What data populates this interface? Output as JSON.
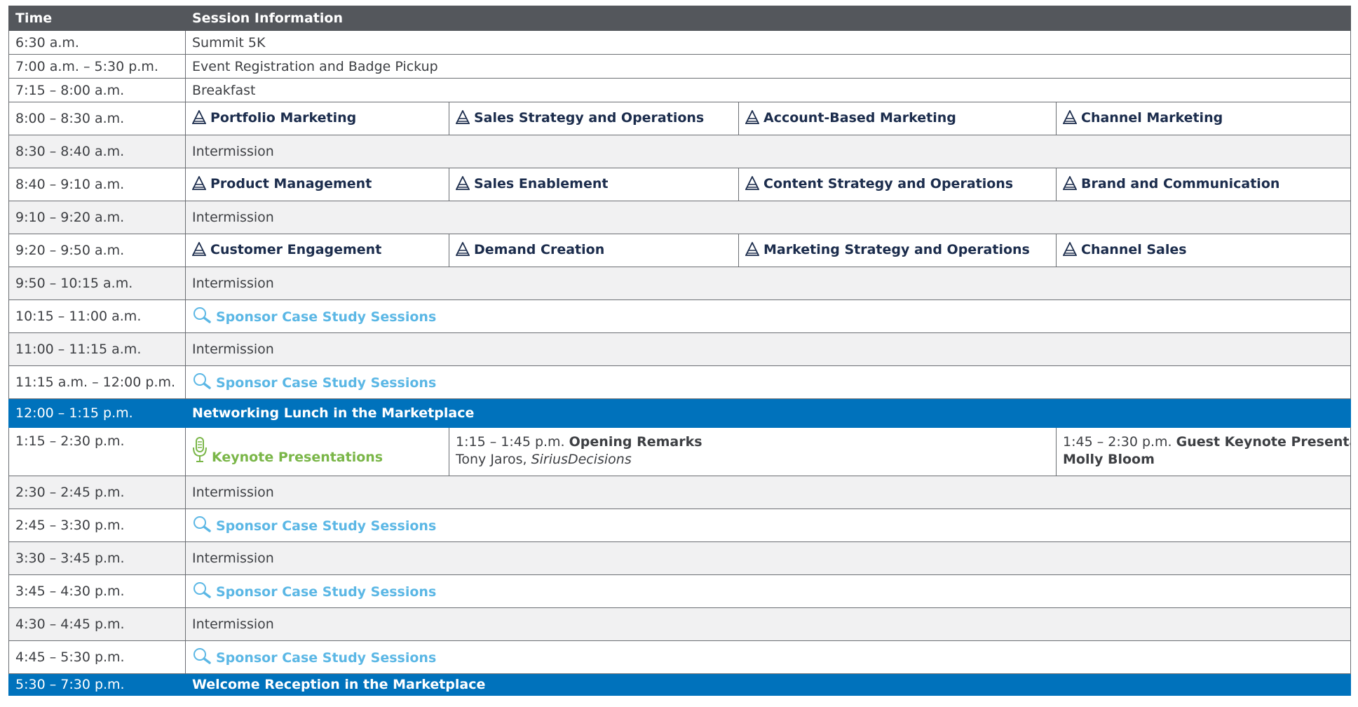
{
  "header": {
    "time": "Time",
    "session": "Session Information"
  },
  "rows": {
    "r1": {
      "time": "6:30 a.m.",
      "session": "Summit 5K"
    },
    "r2": {
      "time": "7:00 a.m. – 5:30 p.m.",
      "session": "Event Registration and Badge Pickup"
    },
    "r3": {
      "time": "7:15 – 8:00 a.m.",
      "session": "Breakfast"
    },
    "r4": {
      "time": "8:00 – 8:30 a.m.",
      "tracks": [
        "Portfolio Marketing",
        "Sales Strategy and Operations",
        "Account-Based Marketing",
        "Channel Marketing"
      ]
    },
    "r5": {
      "time": "8:30 – 8:40 a.m.",
      "session": "Intermission"
    },
    "r6": {
      "time": "8:40 – 9:10 a.m.",
      "tracks": [
        "Product Management",
        "Sales Enablement",
        "Content Strategy and Operations",
        "Brand and Communication"
      ]
    },
    "r7": {
      "time": "9:10 – 9:20 a.m.",
      "session": "Intermission"
    },
    "r8": {
      "time": "9:20 – 9:50 a.m.",
      "tracks": [
        "Customer Engagement",
        "Demand Creation",
        "Marketing Strategy and Operations",
        "Channel Sales"
      ]
    },
    "r9": {
      "time": "9:50 – 10:15 a.m.",
      "session": "Intermission"
    },
    "r10": {
      "time": "10:15 – 11:00 a.m.",
      "session": "Sponsor Case Study Sessions"
    },
    "r11": {
      "time": "11:00 – 11:15 a.m.",
      "session": "Intermission"
    },
    "r12": {
      "time": "11:15 a.m. – 12:00 p.m.",
      "session": "Sponsor Case Study Sessions"
    },
    "r13": {
      "time": "12:00 – 1:15 p.m.",
      "session": "Networking Lunch in the Marketplace"
    },
    "r14": {
      "time": "1:15 – 2:30 p.m.",
      "session": "Keynote Presentations",
      "opening": {
        "time": "1:15 – 1:45 p.m.",
        "title": "Opening Remarks",
        "speaker": "Tony Jaros,",
        "company": "SiriusDecisions"
      },
      "guest": {
        "time": "1:45 – 2:30 p.m.",
        "title_line1": "Guest Keynote Presentation with",
        "title_line2": "Molly Bloom"
      }
    },
    "r15": {
      "time": "2:30 – 2:45 p.m.",
      "session": "Intermission"
    },
    "r16": {
      "time": "2:45 – 3:30 p.m.",
      "session": "Sponsor Case Study Sessions"
    },
    "r17": {
      "time": "3:30 – 3:45 p.m.",
      "session": "Intermission"
    },
    "r18": {
      "time": "3:45 – 4:30 p.m.",
      "session": "Sponsor Case Study Sessions"
    },
    "r19": {
      "time": "4:30 – 4:45 p.m.",
      "session": "Intermission"
    },
    "r20": {
      "time": "4:45 – 5:30 p.m.",
      "session": "Sponsor Case Study Sessions"
    },
    "r21": {
      "time": "5:30 – 7:30 p.m.",
      "session": "Welcome Reception in the Marketplace"
    }
  },
  "icons": {
    "track": "pyramid-icon",
    "sponsor": "magnifier-icon",
    "keynote": "microphone-icon"
  },
  "colors": {
    "header": "#54575c",
    "highlight": "#0072bc",
    "track": "#1b2c4c",
    "sponsor": "#5bb7e5",
    "keynote": "#7ab648",
    "intermission_bg": "#f1f1f2"
  }
}
